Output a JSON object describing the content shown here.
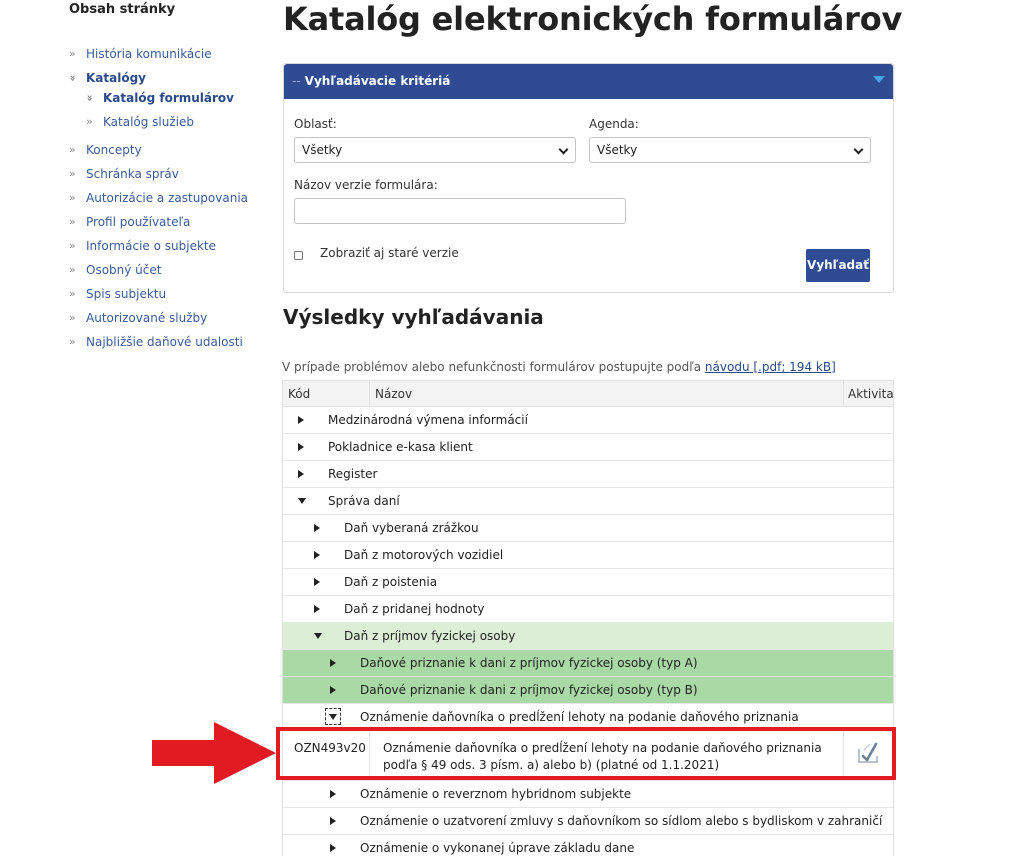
{
  "sidebar": {
    "title": "Obsah stránky",
    "items": [
      {
        "label": "História komunikácie",
        "bullet": "»"
      },
      {
        "label": "Katalógy",
        "bullet": "»"
      },
      {
        "label": "Katalóg formulárov",
        "bullet": "»"
      },
      {
        "label": "Katalóg služieb",
        "bullet": "»"
      },
      {
        "label": "Koncepty",
        "bullet": "»"
      },
      {
        "label": "Schránka správ",
        "bullet": "»"
      },
      {
        "label": "Autorizácie a zastupovania",
        "bullet": "»"
      },
      {
        "label": "Profil používateľa",
        "bullet": "»"
      },
      {
        "label": "Informácie o subjekte",
        "bullet": "»"
      },
      {
        "label": "Osobný účet",
        "bullet": "»"
      },
      {
        "label": "Spis subjektu",
        "bullet": "»"
      },
      {
        "label": "Autorizované služby",
        "bullet": "»"
      },
      {
        "label": "Najbližšie daňové udalosti",
        "bullet": "»"
      }
    ]
  },
  "page": {
    "title": "Katalóg elektronických formulárov"
  },
  "search": {
    "header": "Vyhľadávacie kritériá",
    "header_prefix": "--",
    "oblast_label": "Oblasť:",
    "oblast_value": "Všetky",
    "agenda_label": "Agenda:",
    "agenda_value": "Všetky",
    "nazov_label": "Názov verzie formulára:",
    "nazov_value": "",
    "old_versions_label": "Zobraziť aj staré verzie",
    "old_versions_checked": false,
    "submit_label": "Vyhľadať"
  },
  "results": {
    "title": "Výsledky vyhľadávania",
    "note_text": "V prípade problémov alebo nefunkčnosti formulárov postupujte podľa",
    "note_link": "návodu [.pdf; 194 kB]",
    "columns": [
      "Kód",
      "Názov",
      "Aktivita"
    ],
    "rows": [
      {
        "label": "Medzinárodná výmena informácií"
      },
      {
        "label": "Pokladnice e-kasa klient"
      },
      {
        "label": "Register"
      },
      {
        "label": "Správa daní"
      },
      {
        "label": "Daň vyberaná zrážkou"
      },
      {
        "label": "Daň z motorových vozidiel"
      },
      {
        "label": "Daň z poistenia"
      },
      {
        "label": "Daň z pridanej hodnoty"
      },
      {
        "label": "Daň z príjmov fyzickej osoby"
      },
      {
        "label": "Daňové priznanie k dani z príjmov fyzickej osoby (typ A)"
      },
      {
        "label": "Daňové priznanie k dani z príjmov fyzickej osoby (typ B)"
      },
      {
        "label": "Oznámenie daňovníka o predĺžení lehoty na podanie daňového priznania"
      }
    ],
    "form_row": {
      "code": "OZN493v20",
      "name": "Oznámenie daňovníka o predĺžení lehoty na podanie daňového priznania podľa § 49 ods. 3 písm. a) alebo b) (platné od 1.1.2021)",
      "activity_icon": "fill-form-icon"
    },
    "rows_after": [
      {
        "label": "Oznámenie o reverznom hybridnom subjekte"
      },
      {
        "label": "Oznámenie o uzatvorení zmluvy s daňovníkom so sídlom alebo s bydliskom v zahraničí"
      },
      {
        "label": "Oznámenie o vykonanej úprave základu dane"
      }
    ]
  },
  "colors": {
    "brand_blue": "#2e4b94",
    "light_green": "#dcefd6",
    "green": "#a9d9a4",
    "annotation_red": "#e21b23"
  }
}
